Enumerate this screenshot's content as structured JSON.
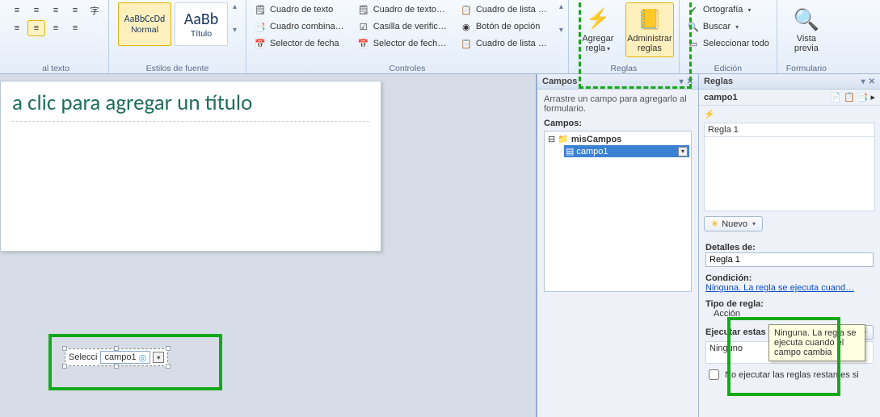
{
  "ribbon": {
    "group_aligntext_label": "al texto",
    "group_fontstyles_label": "Estilos de fuente",
    "style_normal_sample": "AaBbCcDd",
    "style_normal_name": "Normal",
    "style_title_sample": "AaBb",
    "style_title_name": "Título",
    "group_controls_label": "Controles",
    "ctrl_textbox": "Cuadro de texto",
    "ctrl_combo": "Cuadro combina…",
    "ctrl_datepicker": "Selector de fecha",
    "ctrl_textbox2": "Cuadro de texto…",
    "ctrl_checkbox": "Casilla de verific…",
    "ctrl_datepicker2": "Selector de fech…",
    "ctrl_listbox": "Cuadro de lista …",
    "ctrl_option": "Botón de opción",
    "ctrl_listbox2": "Cuadro de lista …",
    "group_rules_label": "Reglas",
    "btn_addrule": "Agregar regla",
    "btn_managerules": "Administrar reglas",
    "group_edit_label": "Edición",
    "btn_spelling": "Ortografía",
    "btn_find": "Buscar",
    "btn_selectall": "Seleccionar todo",
    "group_form_label": "Formulario",
    "btn_preview": "Vista previa"
  },
  "canvas": {
    "title_placeholder": "a clic para agregar un título",
    "dropdown_label_prefix": "Selecci",
    "dropdown_field": "campo1"
  },
  "campos_pane": {
    "title": "Campos",
    "hint": "Arrastre un campo para agregarlo al formulario.",
    "fields_label": "Campos:",
    "root": "misCampos",
    "field1": "campo1"
  },
  "reglas_pane": {
    "title": "Reglas",
    "target": "campo1",
    "rule1": "Regla 1",
    "btn_new": "Nuevo",
    "details_label": "Detalles de:",
    "details_value": "Regla 1",
    "condition_label": "Condición:",
    "condition_link": "Ninguna. La regla se ejecuta cuand…",
    "tooltip": "Ninguna. La regla se ejecuta cuando el campo cambia",
    "ruletype_label": "Tipo de regla:",
    "ruletype_value": "Acción",
    "actions_label": "Ejecutar estas acciones:",
    "actions_none": "Ninguno",
    "btn_add": "Agregar",
    "chk_stop": "No ejecutar las reglas restantes si"
  }
}
